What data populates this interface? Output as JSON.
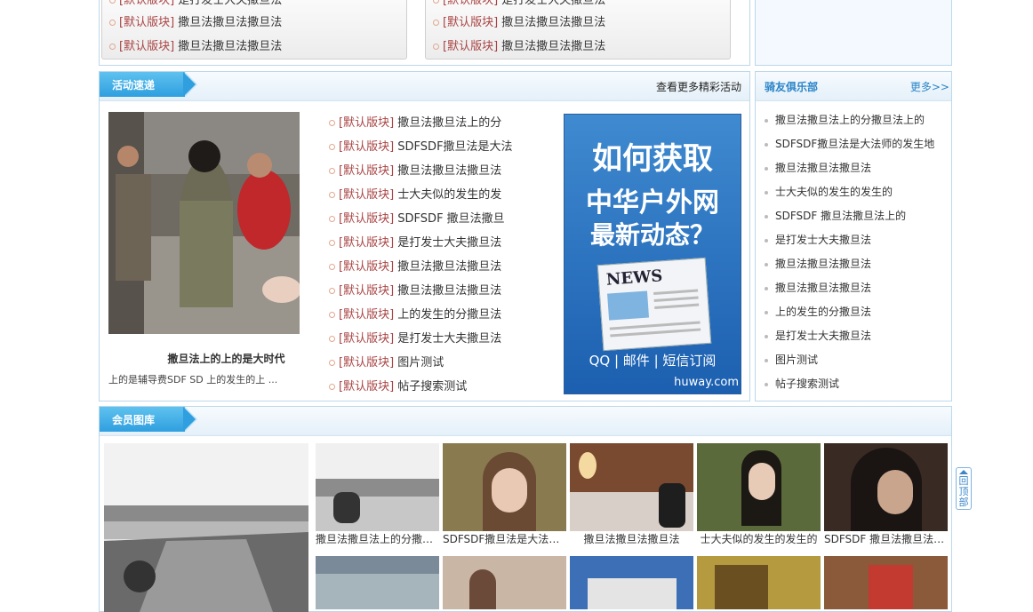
{
  "top_panels": {
    "left_items": [
      {
        "tag": "[默认版块]",
        "text": "是打发士大夫撒旦法"
      },
      {
        "tag": "[默认版块]",
        "text": "撒旦法撒旦法撒旦法"
      },
      {
        "tag": "[默认版块]",
        "text": "撒旦法撒旦法撒旦法"
      }
    ],
    "right_items": [
      {
        "tag": "[默认版块]",
        "text": "是打发士大夫撒旦法"
      },
      {
        "tag": "[默认版块]",
        "text": "撒旦法撒旦法撒旦法"
      },
      {
        "tag": "[默认版块]",
        "text": "撒旦法撒旦法撒旦法"
      }
    ]
  },
  "activity": {
    "title": "活动速递",
    "more_link": "查看更多精彩活动",
    "photo_title": "撒旦法上的上的是大时代",
    "photo_desc": "上的是辅导费SDF SD 上的发生的上 ...",
    "items": [
      {
        "tag": "[默认版块]",
        "text": "撒旦法撒旦法上的分"
      },
      {
        "tag": "[默认版块]",
        "text": "SDFSDF撒旦法是大法"
      },
      {
        "tag": "[默认版块]",
        "text": "撒旦法撒旦法撒旦法"
      },
      {
        "tag": "[默认版块]",
        "text": "士大夫似的发生的发"
      },
      {
        "tag": "[默认版块]",
        "text": "SDFSDF 撒旦法撒旦"
      },
      {
        "tag": "[默认版块]",
        "text": "是打发士大夫撒旦法"
      },
      {
        "tag": "[默认版块]",
        "text": "撒旦法撒旦法撒旦法"
      },
      {
        "tag": "[默认版块]",
        "text": "撒旦法撒旦法撒旦法"
      },
      {
        "tag": "[默认版块]",
        "text": "上的发生的分撒旦法"
      },
      {
        "tag": "[默认版块]",
        "text": "是打发士大夫撒旦法"
      },
      {
        "tag": "[默认版块]",
        "text": "图片测试"
      },
      {
        "tag": "[默认版块]",
        "text": "帖子搜索测试"
      }
    ],
    "ad": {
      "line1": "如何获取",
      "line2": "中华户外网",
      "line3": "最新动态？",
      "news": "NEWS",
      "channels": "QQ | 邮件 | 短信订阅",
      "domain": "huway.com"
    }
  },
  "club": {
    "title": "骑友俱乐部",
    "more": "更多>>",
    "items": [
      "撒旦法撒旦法上的分撒旦法上的",
      "SDFSDF撒旦法是大法师的发生地",
      "撒旦法撒旦法撒旦法",
      "士大夫似的发生的发生的",
      "SDFSDF 撒旦法撒旦法上的",
      "是打发士大夫撒旦法",
      "撒旦法撒旦法撒旦法",
      "撒旦法撒旦法撒旦法",
      "上的发生的分撒旦法",
      "是打发士大夫撒旦法",
      "图片测试",
      "帖子搜索测试"
    ]
  },
  "gallery": {
    "title": "会员图库",
    "captions": [
      "撒旦法撒旦法上的分撒旦法上的",
      "SDFSDF撒旦法是大法师的发生地",
      "撒旦法撒旦法撒旦法",
      "士大夫似的发生的发生的",
      "SDFSDF 撒旦法撒旦法上的"
    ]
  },
  "back_to_top": {
    "label": "回顶部"
  }
}
